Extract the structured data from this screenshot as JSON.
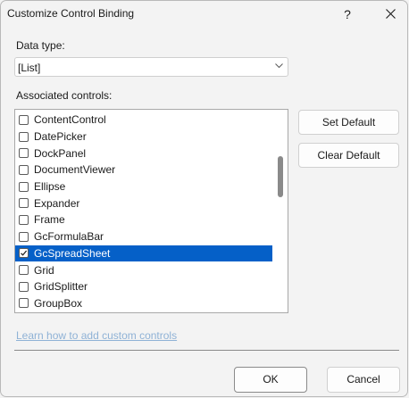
{
  "window": {
    "title": "Customize Control Binding",
    "help_label": "?"
  },
  "data_type": {
    "label": "Data type:",
    "value": "[List]"
  },
  "associated": {
    "label": "Associated controls:",
    "items": [
      {
        "label": "ContentControl",
        "checked": false,
        "selected": false
      },
      {
        "label": "DatePicker",
        "checked": false,
        "selected": false
      },
      {
        "label": "DockPanel",
        "checked": false,
        "selected": false
      },
      {
        "label": "DocumentViewer",
        "checked": false,
        "selected": false
      },
      {
        "label": "Ellipse",
        "checked": false,
        "selected": false
      },
      {
        "label": "Expander",
        "checked": false,
        "selected": false
      },
      {
        "label": "Frame",
        "checked": false,
        "selected": false
      },
      {
        "label": "GcFormulaBar",
        "checked": false,
        "selected": false
      },
      {
        "label": "GcSpreadSheet",
        "checked": true,
        "selected": true
      },
      {
        "label": "Grid",
        "checked": false,
        "selected": false
      },
      {
        "label": "GridSplitter",
        "checked": false,
        "selected": false
      },
      {
        "label": "GroupBox",
        "checked": false,
        "selected": false
      }
    ]
  },
  "buttons": {
    "set_default": "Set Default",
    "clear_default": "Clear Default",
    "ok": "OK",
    "cancel": "Cancel"
  },
  "link": {
    "text": "Learn how to add custom controls"
  },
  "colors": {
    "selection": "#0560c8",
    "link": "#8fb2d6",
    "background": "#f3f3f3"
  }
}
